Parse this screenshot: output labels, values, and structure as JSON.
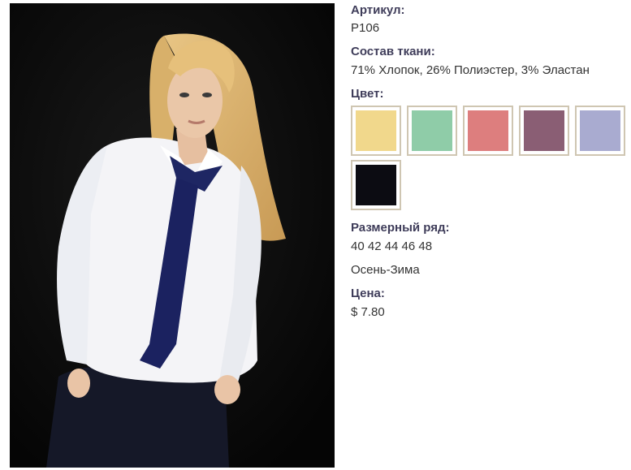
{
  "product": {
    "article_label": "Артикул:",
    "article_value": "Р106",
    "fabric_label": "Состав ткани:",
    "fabric_value": "71% Хлопок, 26% Полиэстер, 3% Эластан",
    "color_label": "Цвет:",
    "colors": [
      {
        "name": "yellow",
        "hex": "#f1d88c"
      },
      {
        "name": "mint",
        "hex": "#8fcca8"
      },
      {
        "name": "rose",
        "hex": "#dd7e7e"
      },
      {
        "name": "mauve",
        "hex": "#8a5e74"
      },
      {
        "name": "lavender",
        "hex": "#a9abd0"
      },
      {
        "name": "black",
        "hex": "#0c0c12"
      }
    ],
    "sizes_label": "Размерный ряд:",
    "sizes_value": "40 42 44 46 48",
    "season": "Осень-Зима",
    "price_label": "Цена:",
    "price_value": "$ 7.80"
  }
}
